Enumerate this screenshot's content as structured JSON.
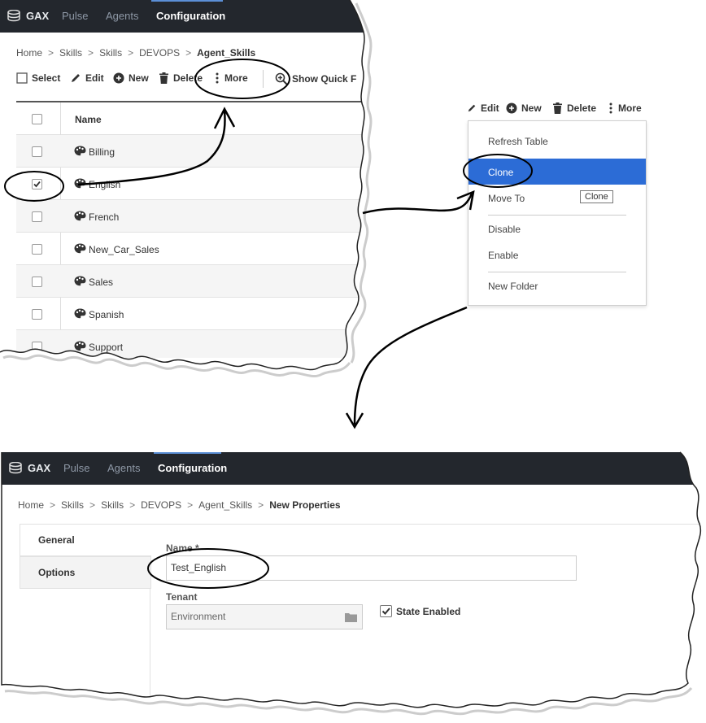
{
  "nav": {
    "brand": "GAX",
    "items": [
      "Pulse",
      "Agents",
      "Configuration"
    ]
  },
  "top_panel": {
    "breadcrumb": [
      "Home",
      "Skills",
      "Skills",
      "DEVOPS",
      "Agent_Skills"
    ],
    "toolbar": {
      "select": "Select",
      "edit": "Edit",
      "new": "New",
      "delete": "Delete",
      "more": "More",
      "show_quick": "Show Quick F"
    },
    "table": {
      "header_name": "Name",
      "rows": [
        {
          "name": "Billing",
          "checked": false
        },
        {
          "name": "English",
          "checked": true
        },
        {
          "name": "French",
          "checked": false
        },
        {
          "name": "New_Car_Sales",
          "checked": false
        },
        {
          "name": "Sales",
          "checked": false
        },
        {
          "name": "Spanish",
          "checked": false
        },
        {
          "name": "Support",
          "checked": false
        }
      ]
    }
  },
  "menu_panel": {
    "toolbar": {
      "edit": "Edit",
      "new": "New",
      "delete": "Delete",
      "more": "More"
    },
    "items": {
      "refresh": "Refresh Table",
      "clone": "Clone",
      "move": "Move To",
      "disable": "Disable",
      "enable": "Enable",
      "new_folder": "New Folder"
    },
    "tooltip": "Clone"
  },
  "bottom_panel": {
    "breadcrumb": [
      "Home",
      "Skills",
      "Skills",
      "DEVOPS",
      "Agent_Skills",
      "New Properties"
    ],
    "tabs": [
      "General",
      "Options"
    ],
    "form": {
      "name_label": "Name *",
      "name_value": "Test_English",
      "tenant_label": "Tenant",
      "tenant_value": "Environment",
      "state_label": "State Enabled",
      "state_checked": true
    }
  },
  "colors": {
    "navbar": "#23272d",
    "accent": "#2c6cd6",
    "nav_active": "#ffffff",
    "nav_inactive": "#8e98a6"
  }
}
